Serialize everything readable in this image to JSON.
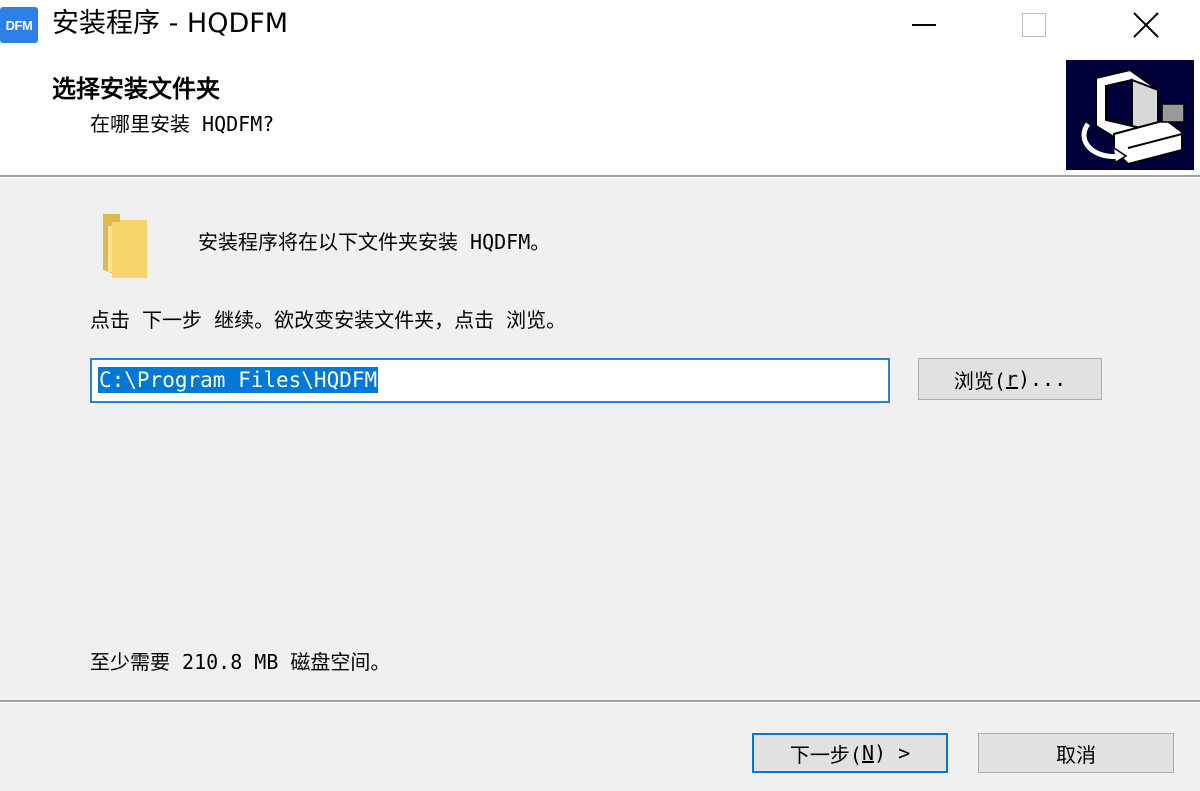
{
  "window": {
    "icon_label": "DFM",
    "title": "安装程序 - HQDFM",
    "minimize_icon": "minimize-icon",
    "maximize_icon": "maximize-icon",
    "close_icon": "close-icon"
  },
  "header": {
    "title": "选择安装文件夹",
    "subtitle": "在哪里安装 HQDFM?",
    "image_icon": "computer-install-icon"
  },
  "content": {
    "folder_icon": "folder-icon",
    "intro": "安装程序将在以下文件夹安装 HQDFM。",
    "instruction": "点击 下一步 继续。欲改变安装文件夹，点击 浏览。",
    "path_value": "C:\\Program Files\\HQDFM",
    "browse_prefix": "浏览(",
    "browse_accel": "r",
    "browse_suffix": ")...",
    "space_required": "至少需要 210.8 MB 磁盘空间。"
  },
  "footer": {
    "next_prefix": "下一步(",
    "next_accel": "N",
    "next_suffix": ") >",
    "cancel_label": "取消"
  },
  "colors": {
    "accent": "#0078d7",
    "header_bg": "#ffffff",
    "body_bg": "#f0f0f0",
    "folder": "#f8d775"
  }
}
